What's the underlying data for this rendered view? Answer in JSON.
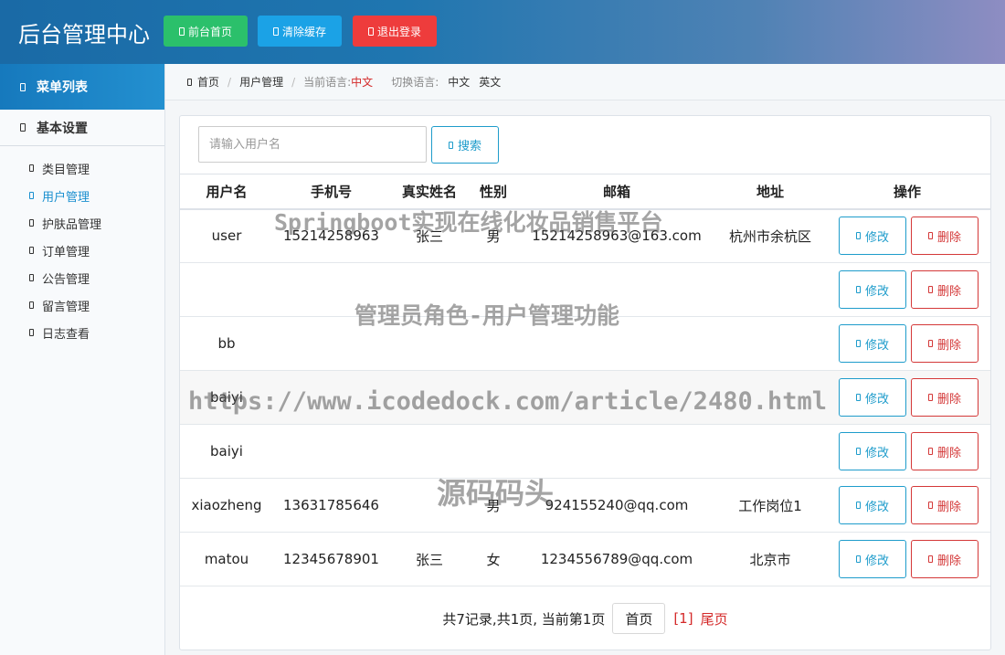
{
  "header": {
    "title": "后台管理中心",
    "buttons": {
      "home": "前台首页",
      "clear_cache": "清除缓存",
      "logout": "退出登录"
    }
  },
  "sidebar": {
    "menu_title": "菜单列表",
    "group_title": "基本设置",
    "items": [
      {
        "label": "类目管理"
      },
      {
        "label": "用户管理"
      },
      {
        "label": "护肤品管理"
      },
      {
        "label": "订单管理"
      },
      {
        "label": "公告管理"
      },
      {
        "label": "留言管理"
      },
      {
        "label": "日志查看"
      }
    ],
    "active_index": 1
  },
  "breadcrumb": {
    "home": "首页",
    "current": "用户管理",
    "lang_label": "当前语言:",
    "lang_value": "中文",
    "switch_label": "切换语言:",
    "lang_zh": "中文",
    "lang_en": "英文"
  },
  "search": {
    "placeholder": "请输入用户名",
    "value": "",
    "button": "搜索"
  },
  "table": {
    "headers": [
      "用户名",
      "手机号",
      "真实姓名",
      "性别",
      "邮箱",
      "地址",
      "操作"
    ],
    "edit_label": "修改",
    "delete_label": "删除",
    "rows": [
      {
        "username": "user",
        "phone": "15214258963",
        "realname": "张三",
        "sex": "男",
        "email": "15214258963@163.com",
        "address": "杭州市余杭区"
      },
      {
        "username": "",
        "phone": "",
        "realname": "",
        "sex": "",
        "email": "",
        "address": ""
      },
      {
        "username": "bb",
        "phone": "",
        "realname": "",
        "sex": "",
        "email": "",
        "address": ""
      },
      {
        "username": "baiyi",
        "phone": "",
        "realname": "",
        "sex": "",
        "email": "",
        "address": ""
      },
      {
        "username": "baiyi",
        "phone": "",
        "realname": "",
        "sex": "",
        "email": "",
        "address": ""
      },
      {
        "username": "xiaozheng",
        "phone": "13631785646",
        "realname": "",
        "sex": "男",
        "email": "924155240@qq.com",
        "address": "工作岗位1"
      },
      {
        "username": "matou",
        "phone": "12345678901",
        "realname": "张三",
        "sex": "女",
        "email": "1234556789@qq.com",
        "address": "北京市"
      }
    ]
  },
  "pagination": {
    "summary": "共7记录,共1页, 当前第1页",
    "first": "首页",
    "current": "[1]",
    "last": "尾页"
  },
  "watermarks": {
    "line1": "Springboot实现在线化妆品销售平台",
    "line2": "管理员角色-用户管理功能",
    "line3": "https://www.icodedock.com/article/2480.html",
    "line4": "源码码头"
  }
}
